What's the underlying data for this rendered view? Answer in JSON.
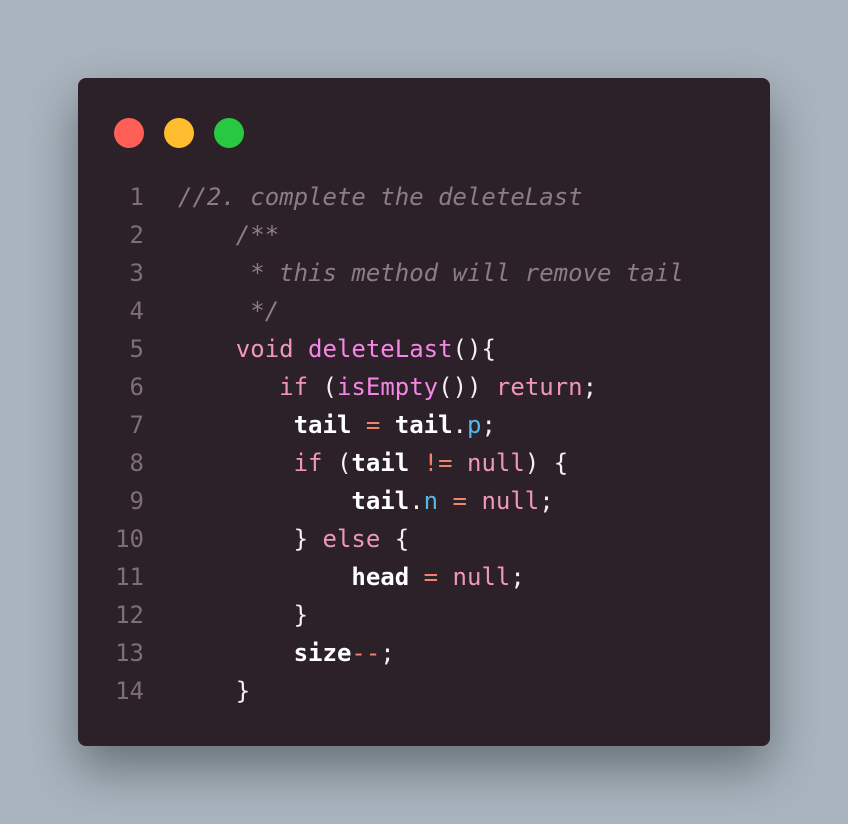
{
  "window": {
    "dots": [
      "close",
      "minimize",
      "maximize"
    ],
    "colors": {
      "close": "#ff5f57",
      "minimize": "#febc2e",
      "maximize": "#28c840",
      "background": "#2c2128"
    }
  },
  "code": {
    "lines": [
      {
        "n": "1",
        "tokens": [
          {
            "t": "cm",
            "v": "//2. complete the deleteLast"
          }
        ]
      },
      {
        "n": "2",
        "tokens": [
          {
            "t": "cm",
            "v": "    /**"
          }
        ]
      },
      {
        "n": "3",
        "tokens": [
          {
            "t": "cm",
            "v": "     * this method will remove tail"
          }
        ]
      },
      {
        "n": "4",
        "tokens": [
          {
            "t": "cm",
            "v": "     */"
          }
        ]
      },
      {
        "n": "5",
        "tokens": [
          {
            "t": "pu",
            "v": "    "
          },
          {
            "t": "kw",
            "v": "void"
          },
          {
            "t": "pu",
            "v": " "
          },
          {
            "t": "fn",
            "v": "deleteLast"
          },
          {
            "t": "pu",
            "v": "(){"
          }
        ]
      },
      {
        "n": "6",
        "tokens": [
          {
            "t": "pu",
            "v": "       "
          },
          {
            "t": "kw",
            "v": "if"
          },
          {
            "t": "pu",
            "v": " ("
          },
          {
            "t": "fn",
            "v": "isEmpty"
          },
          {
            "t": "pu",
            "v": "()) "
          },
          {
            "t": "kw",
            "v": "return"
          },
          {
            "t": "pu",
            "v": ";"
          }
        ]
      },
      {
        "n": "7",
        "tokens": [
          {
            "t": "pu",
            "v": "        "
          },
          {
            "t": "id",
            "v": "tail"
          },
          {
            "t": "pu",
            "v": " "
          },
          {
            "t": "op",
            "v": "="
          },
          {
            "t": "pu",
            "v": " "
          },
          {
            "t": "id",
            "v": "tail"
          },
          {
            "t": "pu",
            "v": "."
          },
          {
            "t": "pr",
            "v": "p"
          },
          {
            "t": "pu",
            "v": ";"
          }
        ]
      },
      {
        "n": "8",
        "tokens": [
          {
            "t": "pu",
            "v": "        "
          },
          {
            "t": "kw",
            "v": "if"
          },
          {
            "t": "pu",
            "v": " ("
          },
          {
            "t": "id",
            "v": "tail"
          },
          {
            "t": "pu",
            "v": " "
          },
          {
            "t": "op",
            "v": "!="
          },
          {
            "t": "pu",
            "v": " "
          },
          {
            "t": "kw",
            "v": "null"
          },
          {
            "t": "pu",
            "v": ") {"
          }
        ]
      },
      {
        "n": "9",
        "tokens": [
          {
            "t": "pu",
            "v": "            "
          },
          {
            "t": "id",
            "v": "tail"
          },
          {
            "t": "pu",
            "v": "."
          },
          {
            "t": "pr",
            "v": "n"
          },
          {
            "t": "pu",
            "v": " "
          },
          {
            "t": "op",
            "v": "="
          },
          {
            "t": "pu",
            "v": " "
          },
          {
            "t": "kw",
            "v": "null"
          },
          {
            "t": "pu",
            "v": ";"
          }
        ]
      },
      {
        "n": "10",
        "tokens": [
          {
            "t": "pu",
            "v": "        } "
          },
          {
            "t": "kw",
            "v": "else"
          },
          {
            "t": "pu",
            "v": " {"
          }
        ]
      },
      {
        "n": "11",
        "tokens": [
          {
            "t": "pu",
            "v": "            "
          },
          {
            "t": "id",
            "v": "head"
          },
          {
            "t": "pu",
            "v": " "
          },
          {
            "t": "op",
            "v": "="
          },
          {
            "t": "pu",
            "v": " "
          },
          {
            "t": "kw",
            "v": "null"
          },
          {
            "t": "pu",
            "v": ";"
          }
        ]
      },
      {
        "n": "12",
        "tokens": [
          {
            "t": "pu",
            "v": "        }"
          }
        ]
      },
      {
        "n": "13",
        "tokens": [
          {
            "t": "pu",
            "v": "        "
          },
          {
            "t": "id",
            "v": "size"
          },
          {
            "t": "op",
            "v": "--"
          },
          {
            "t": "pu",
            "v": ";"
          }
        ]
      },
      {
        "n": "14",
        "tokens": [
          {
            "t": "pu",
            "v": "    }"
          }
        ]
      }
    ]
  }
}
